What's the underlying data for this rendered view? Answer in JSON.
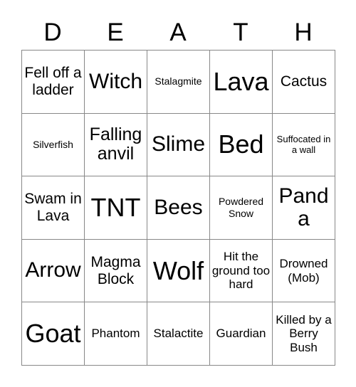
{
  "card": {
    "header_letters": [
      "D",
      "E",
      "A",
      "T",
      "H"
    ],
    "columns": 5,
    "rows": 5,
    "colors": {
      "background": "#ffffff",
      "text": "#000000",
      "grid_line": "#888888"
    },
    "cells": [
      {
        "text": "Fell off a ladder",
        "size": "md"
      },
      {
        "text": "Witch",
        "size": "xl"
      },
      {
        "text": "Stalagmite",
        "size": "xs"
      },
      {
        "text": "Lava",
        "size": "xxl"
      },
      {
        "text": "Cactus",
        "size": "md"
      },
      {
        "text": "Silverfish",
        "size": "xs"
      },
      {
        "text": "Falling anvil",
        "size": "lg"
      },
      {
        "text": "Slime",
        "size": "xl"
      },
      {
        "text": "Bed",
        "size": "xxl"
      },
      {
        "text": "Suffocated in a wall",
        "size": "xxs"
      },
      {
        "text": "Swam in Lava",
        "size": "md"
      },
      {
        "text": "TNT",
        "size": "xxl"
      },
      {
        "text": "Bees",
        "size": "xl"
      },
      {
        "text": "Powdered Snow",
        "size": "xs"
      },
      {
        "text": "Panda",
        "size": "xl"
      },
      {
        "text": "Arrow",
        "size": "xl"
      },
      {
        "text": "Magma Block",
        "size": "md"
      },
      {
        "text": "Wolf",
        "size": "xxl"
      },
      {
        "text": "Hit the ground too hard",
        "size": "sm"
      },
      {
        "text": "Drowned (Mob)",
        "size": "sm"
      },
      {
        "text": "Goat",
        "size": "xxl"
      },
      {
        "text": "Phantom",
        "size": "sm"
      },
      {
        "text": "Stalactite",
        "size": "sm"
      },
      {
        "text": "Guardian",
        "size": "sm"
      },
      {
        "text": "Killed by a Berry Bush",
        "size": "sm"
      }
    ]
  }
}
